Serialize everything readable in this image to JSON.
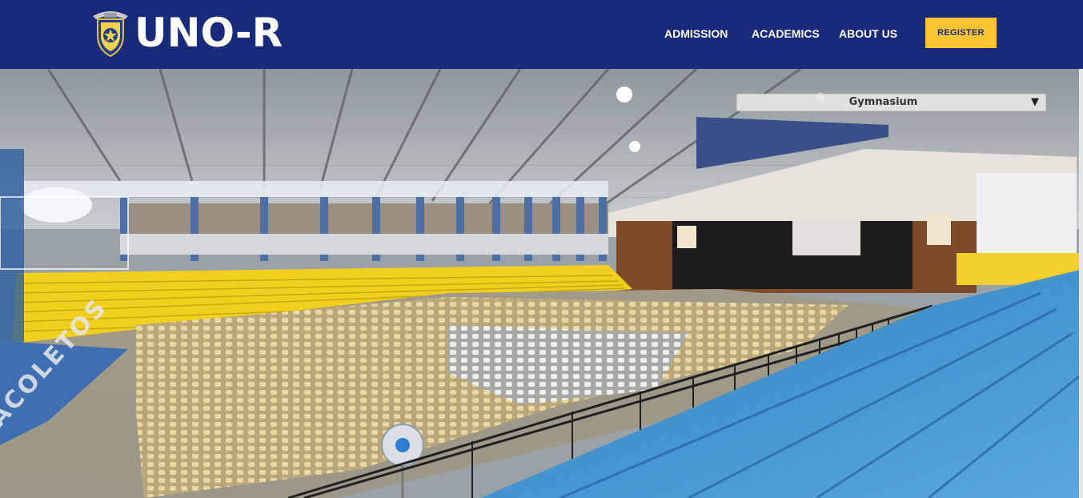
{
  "brand": {
    "name": "UNO-R",
    "crest_icon": "university-crest-icon"
  },
  "nav": {
    "admission": "ADMISSION",
    "academics": "ACADEMICS",
    "about": "ABOUT US",
    "register": "REGISTER"
  },
  "tour": {
    "selected_location": "Gymnasium",
    "caret": "▼",
    "floor_text": "ACOLETOS"
  },
  "colors": {
    "nav_bg": "#1a2a7a",
    "accent": "#fbc531",
    "bleachers_yellow": "#f1cf1f",
    "bleachers_blue": "#3f8fc9"
  }
}
